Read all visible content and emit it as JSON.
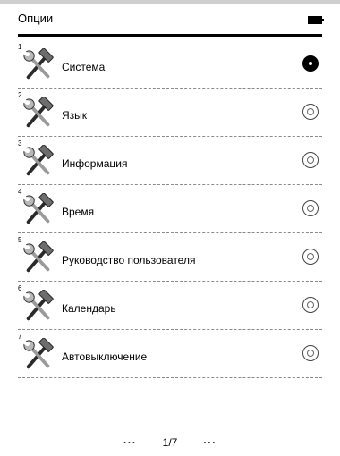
{
  "header": {
    "title": "Опции",
    "battery_icon": "battery-full-icon"
  },
  "options": [
    {
      "number": "1",
      "label": "Система",
      "icon": "tools-icon",
      "selected": true
    },
    {
      "number": "2",
      "label": "Язык",
      "icon": "tools-icon",
      "selected": false
    },
    {
      "number": "3",
      "label": "Информация",
      "icon": "tools-icon",
      "selected": false
    },
    {
      "number": "4",
      "label": "Время",
      "icon": "tools-icon",
      "selected": false
    },
    {
      "number": "5",
      "label": "Руководство пользователя",
      "icon": "tools-icon",
      "selected": false
    },
    {
      "number": "6",
      "label": "Календарь",
      "icon": "tools-icon",
      "selected": false
    },
    {
      "number": "7",
      "label": "Автовыключение",
      "icon": "tools-icon",
      "selected": false
    }
  ],
  "pager": {
    "prev": "···",
    "page": "1/7",
    "next": "···"
  }
}
